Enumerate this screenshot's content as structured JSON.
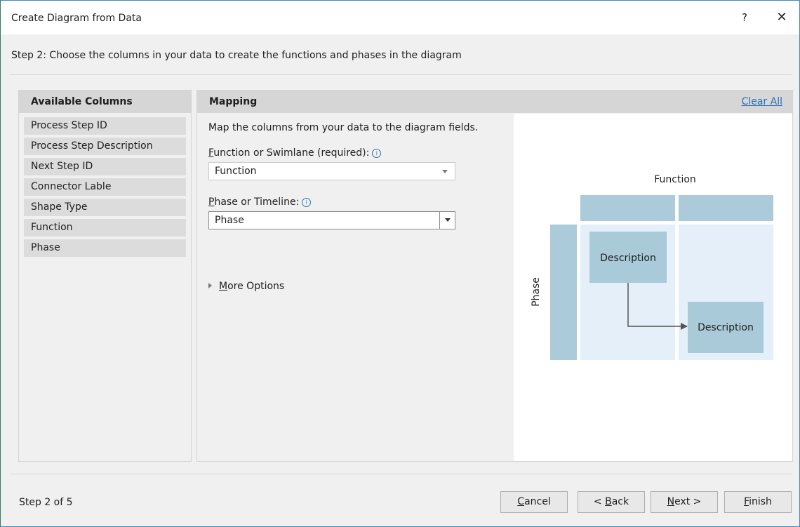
{
  "window": {
    "title": "Create Diagram from Data",
    "help_label": "?",
    "close_label": "✕"
  },
  "step_header": "Step 2: Choose the columns in your data to create the functions and phases in the diagram",
  "available_columns": {
    "header": "Available Columns",
    "items": [
      "Process Step ID",
      "Process Step Description",
      "Next Step ID",
      "Connector Lable",
      "Shape Type",
      "Function",
      "Phase"
    ]
  },
  "mapping": {
    "header": "Mapping",
    "clear_all": "Clear All",
    "description": "Map the columns from your data to the diagram fields.",
    "function_field": {
      "label_key": "F",
      "label_rest": "unction or Swimlane (required):",
      "value": "Function"
    },
    "phase_field": {
      "label_key": "P",
      "label_rest": "hase or Timeline:",
      "value": "Phase"
    },
    "more_options": {
      "key": "M",
      "rest": "ore Options"
    }
  },
  "preview": {
    "function_label": "Function",
    "phase_label": "Phase",
    "box1": "Description",
    "box2": "Description",
    "colors": {
      "header": "#abcbdb",
      "lane": "#e5eff9",
      "box": "#a9cad9",
      "arrow": "#555555"
    }
  },
  "footer": {
    "step_count": "Step 2 of 5",
    "cancel": {
      "key": "C",
      "rest": "ancel"
    },
    "back": {
      "prefix": "< ",
      "key": "B",
      "rest": "ack"
    },
    "next": {
      "key": "N",
      "rest": "ext >"
    },
    "finish": {
      "key": "F",
      "rest": "inish"
    }
  },
  "icons": {
    "info": "info-icon",
    "dropdown": "chevron-down-icon",
    "expand": "expand-triangle-icon"
  }
}
